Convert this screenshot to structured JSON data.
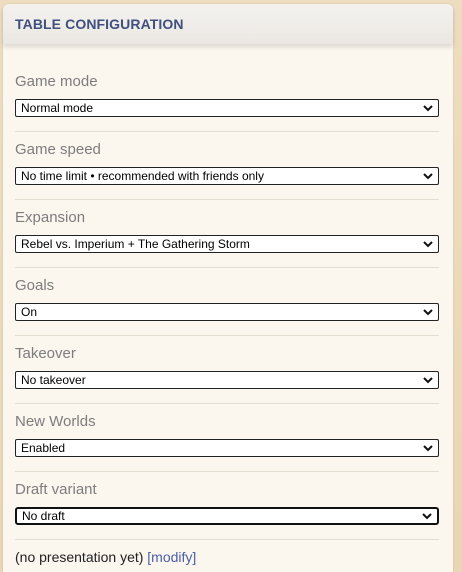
{
  "panel": {
    "title": "TABLE CONFIGURATION"
  },
  "options": [
    {
      "label": "Game mode",
      "value": "Normal mode"
    },
    {
      "label": "Game speed",
      "value": "No time limit • recommended with friends only"
    },
    {
      "label": "Expansion",
      "value": "Rebel vs. Imperium + The Gathering Storm"
    },
    {
      "label": "Goals",
      "value": "On"
    },
    {
      "label": "Takeover",
      "value": "No takeover"
    },
    {
      "label": "New Worlds",
      "value": "Enabled"
    },
    {
      "label": "Draft variant",
      "value": "No draft"
    }
  ],
  "presentation": {
    "text": "(no presentation yet)",
    "link": "[modify]"
  }
}
